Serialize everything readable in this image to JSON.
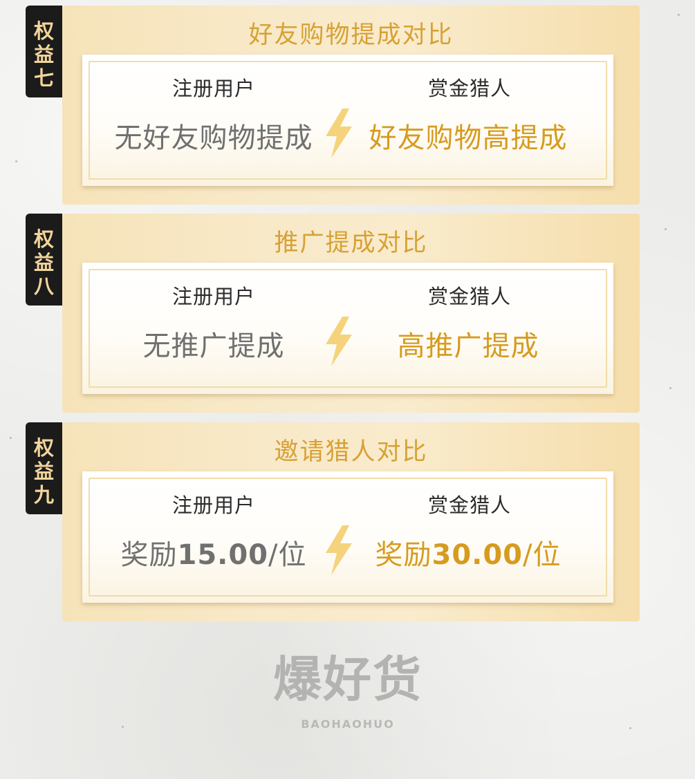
{
  "cards": [
    {
      "tag": [
        "权",
        "益",
        "七"
      ],
      "title": "好友购物提成对比",
      "left_label": "注册用户",
      "right_label": "赏金猎人",
      "left_value": "无好友购物提成",
      "right_value": "好友购物高提成"
    },
    {
      "tag": [
        "权",
        "益",
        "八"
      ],
      "title": "推广提成对比",
      "left_label": "注册用户",
      "right_label": "赏金猎人",
      "left_value": "无推广提成",
      "right_value": "高推广提成"
    },
    {
      "tag": [
        "权",
        "益",
        "九"
      ],
      "title": "邀请猎人对比",
      "left_label": "注册用户",
      "right_label": "赏金猎人",
      "left_prefix": "奖励",
      "left_number": "15.00",
      "left_suffix": "/位",
      "right_prefix": "奖励",
      "right_number": "30.00",
      "right_suffix": "/位"
    }
  ],
  "logo": {
    "name": "爆好货",
    "pinyin": "BAOHAOHUO"
  },
  "colors": {
    "accent_gold": "#d69b1f",
    "title_gold": "#d7a134",
    "tag_bg": "#1b1b1b",
    "tag_text": "#f1d59b",
    "bolt": "#f5d27c"
  }
}
